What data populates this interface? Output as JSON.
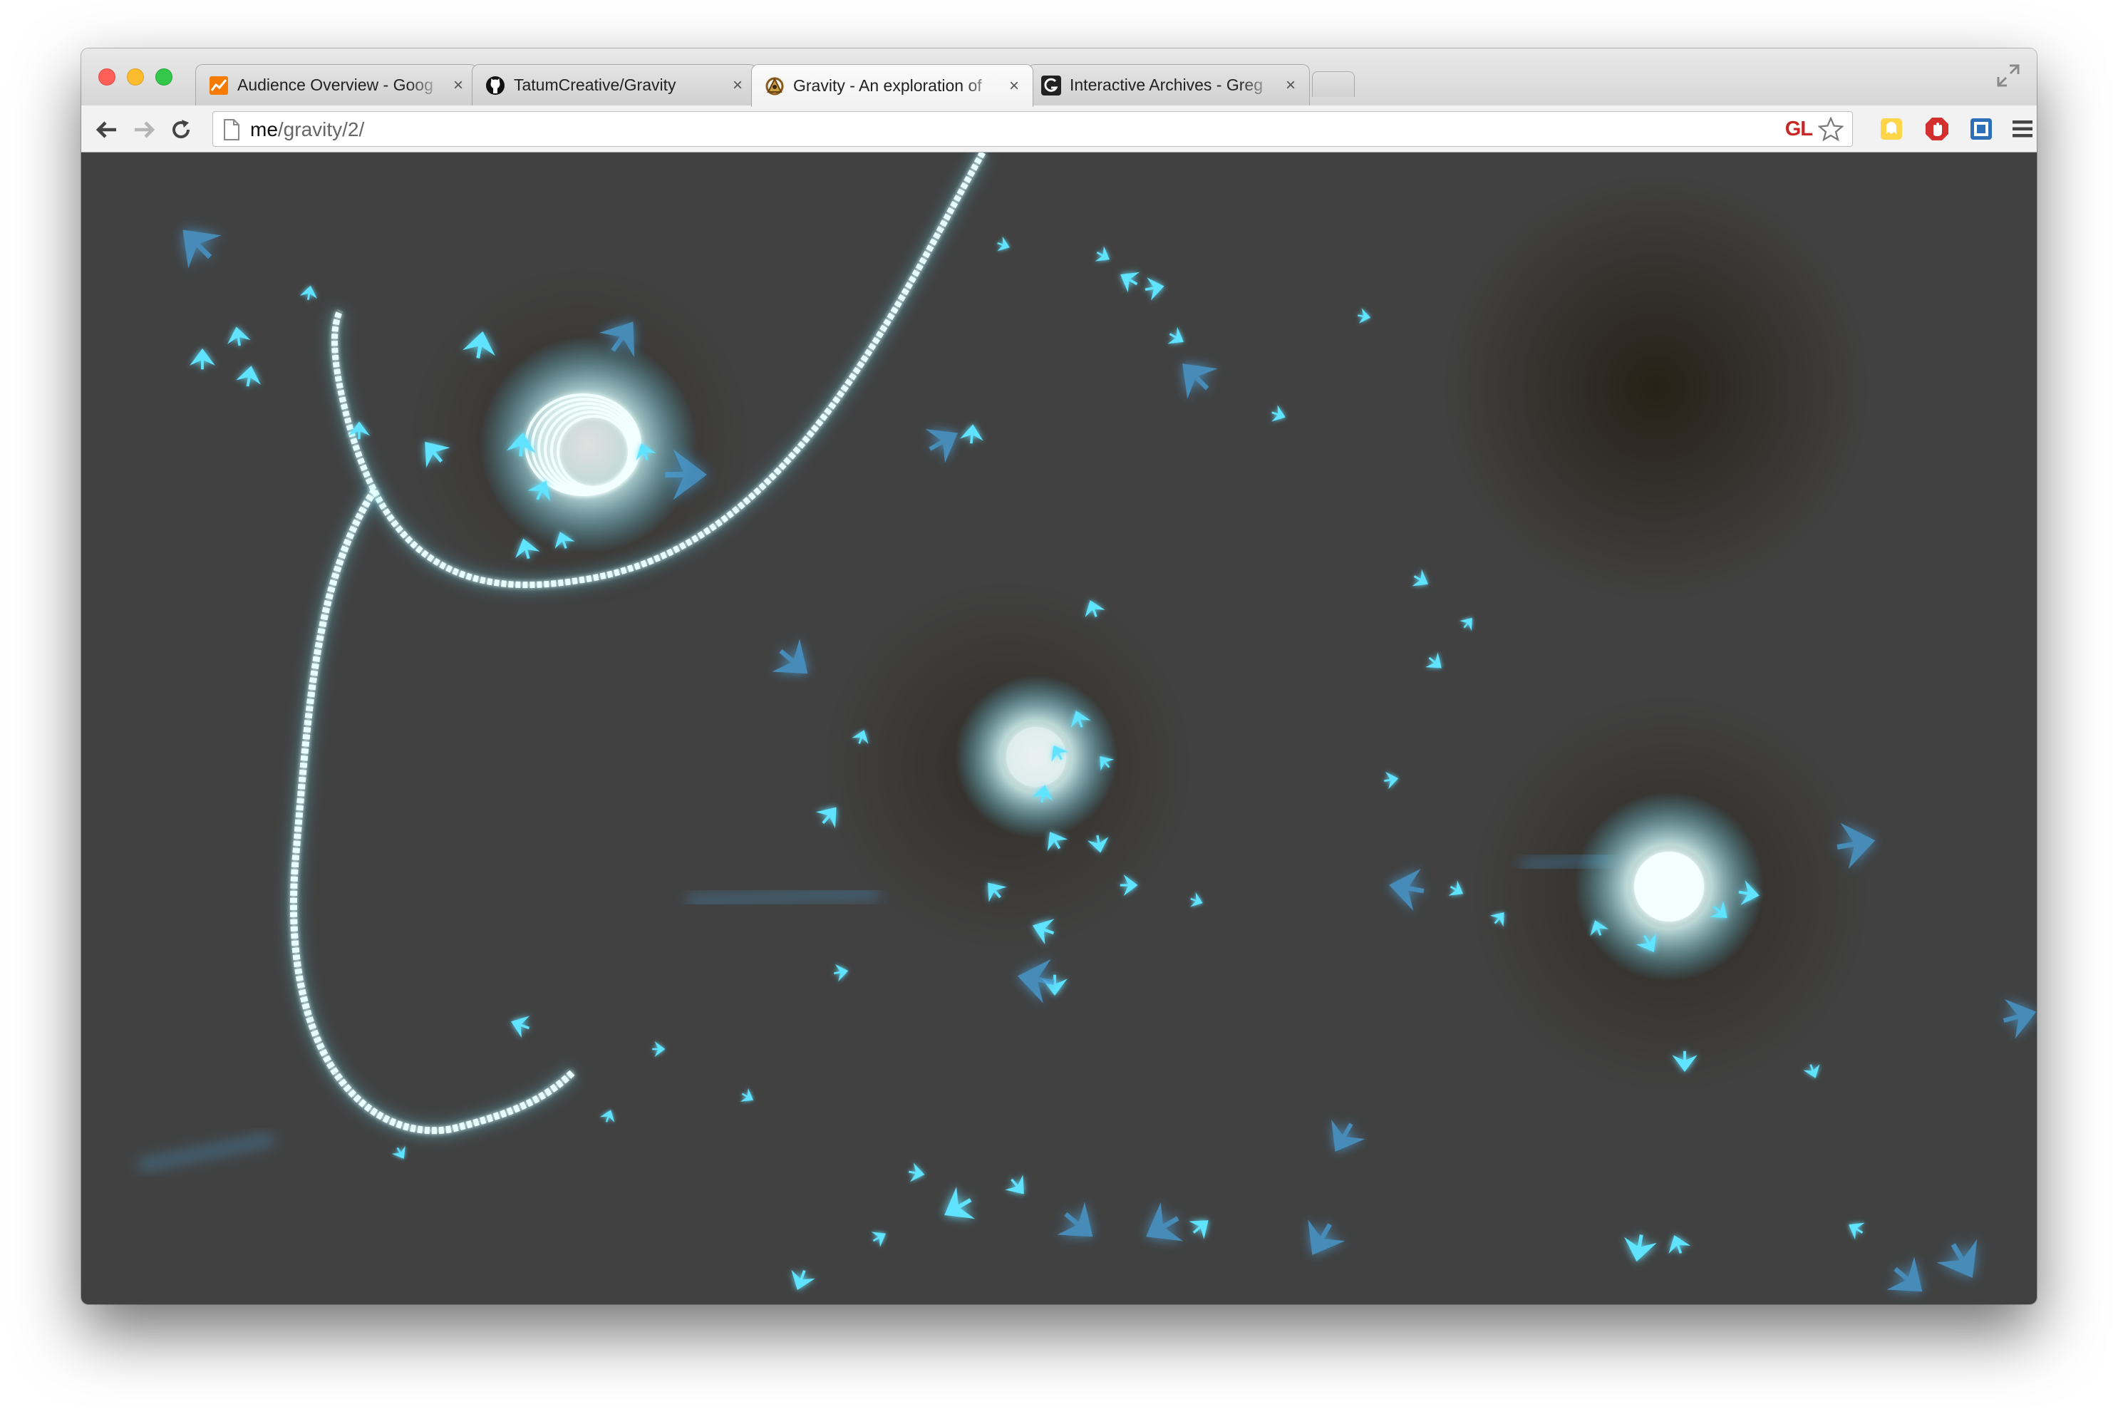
{
  "browser": {
    "tabs": [
      {
        "title": "Audience Overview - Goog",
        "favicon": "analytics-icon",
        "active": false
      },
      {
        "title": "TatumCreative/Gravity",
        "favicon": "github-icon",
        "active": false
      },
      {
        "title": "Gravity - An exploration of",
        "favicon": "gravity-site-icon",
        "active": true
      },
      {
        "title": "Interactive Archives - Greg",
        "favicon": "site-g-icon",
        "active": false
      }
    ],
    "tab_close_glyph": "×",
    "url_host": "me",
    "url_path": "/gravity/2/",
    "gl_badge": "GL",
    "extensions": [
      "bookmark-star-icon",
      "ghostery-icon",
      "adblock-icon",
      "extension-icon",
      "menu-icon"
    ]
  },
  "colors": {
    "arrow": "#5fe3ff",
    "arrow_dim": "#4a9fd6",
    "glow": "#e8ffff",
    "canvas_bg": "#414141"
  }
}
